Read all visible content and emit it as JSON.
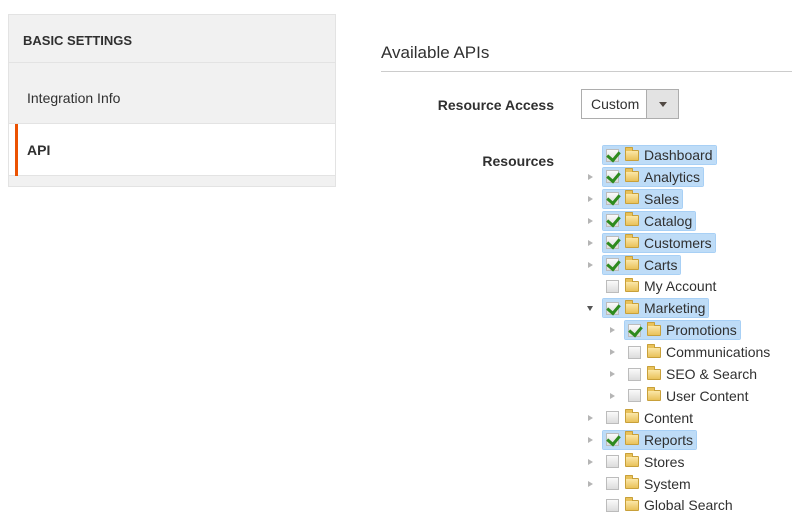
{
  "sidebar": {
    "title": "BASIC SETTINGS",
    "items": [
      {
        "label": "Integration Info",
        "active": false
      },
      {
        "label": "API",
        "active": true
      }
    ]
  },
  "main": {
    "section_title": "Available APIs",
    "resource_access_label": "Resource Access",
    "resource_access_value": "Custom",
    "resources_label": "Resources"
  },
  "tree": [
    {
      "label": "Dashboard",
      "level": 0,
      "toggle": "none",
      "checked": true,
      "selected": true
    },
    {
      "label": "Analytics",
      "level": 0,
      "toggle": "collapsed",
      "checked": true,
      "selected": true
    },
    {
      "label": "Sales",
      "level": 0,
      "toggle": "collapsed",
      "checked": true,
      "selected": true
    },
    {
      "label": "Catalog",
      "level": 0,
      "toggle": "collapsed",
      "checked": true,
      "selected": true
    },
    {
      "label": "Customers",
      "level": 0,
      "toggle": "collapsed",
      "checked": true,
      "selected": true
    },
    {
      "label": "Carts",
      "level": 0,
      "toggle": "collapsed",
      "checked": true,
      "selected": true
    },
    {
      "label": "My Account",
      "level": 0,
      "toggle": "none",
      "checked": false,
      "selected": false
    },
    {
      "label": "Marketing",
      "level": 0,
      "toggle": "expanded",
      "checked": true,
      "selected": true
    },
    {
      "label": "Promotions",
      "level": 1,
      "toggle": "collapsed",
      "checked": true,
      "selected": true
    },
    {
      "label": "Communications",
      "level": 1,
      "toggle": "collapsed",
      "checked": false,
      "selected": false
    },
    {
      "label": "SEO & Search",
      "level": 1,
      "toggle": "collapsed",
      "checked": false,
      "selected": false
    },
    {
      "label": "User Content",
      "level": 1,
      "toggle": "collapsed",
      "checked": false,
      "selected": false
    },
    {
      "label": "Content",
      "level": 0,
      "toggle": "collapsed",
      "checked": false,
      "selected": false
    },
    {
      "label": "Reports",
      "level": 0,
      "toggle": "collapsed",
      "checked": true,
      "selected": true
    },
    {
      "label": "Stores",
      "level": 0,
      "toggle": "collapsed",
      "checked": false,
      "selected": false
    },
    {
      "label": "System",
      "level": 0,
      "toggle": "collapsed",
      "checked": false,
      "selected": false
    },
    {
      "label": "Global Search",
      "level": 0,
      "toggle": "none",
      "checked": false,
      "selected": false
    }
  ],
  "icons": {
    "checkbox": "checkbox-icon",
    "folder": "folder-icon",
    "expand": "triangle-right-icon",
    "collapse": "triangle-down-icon",
    "dropdown": "chevron-down-icon"
  },
  "colors": {
    "accent": "#eb5202",
    "selected_bg": "#bedcf7",
    "check_green": "#2e8b1e"
  }
}
